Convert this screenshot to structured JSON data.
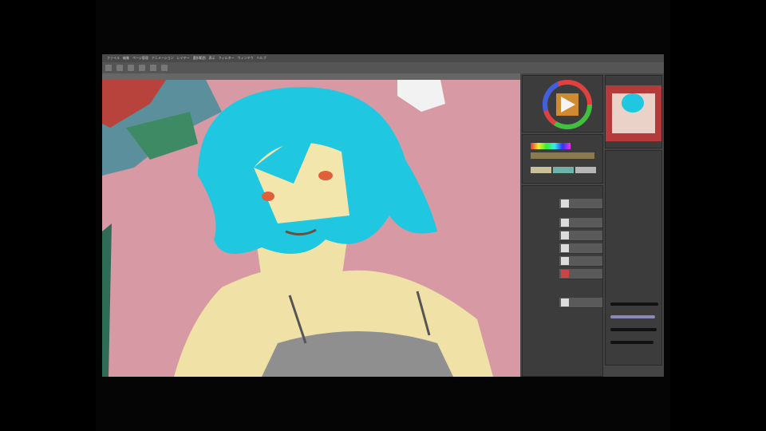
{
  "menu": {
    "items": [
      "ファイル",
      "編集",
      "ページ管理",
      "アニメーション",
      "レイヤー",
      "選択範囲",
      "表示",
      "フィルター",
      "ウィンドウ",
      "ヘルプ"
    ]
  },
  "colors": {
    "accent": "#1fc7e0",
    "canvas_bg": "#d79aa5",
    "panel_bg": "#3c3c3c"
  },
  "icons": [
    "pen-icon",
    "brush-icon",
    "eraser-icon",
    "fill-icon",
    "select-icon",
    "move-icon"
  ]
}
